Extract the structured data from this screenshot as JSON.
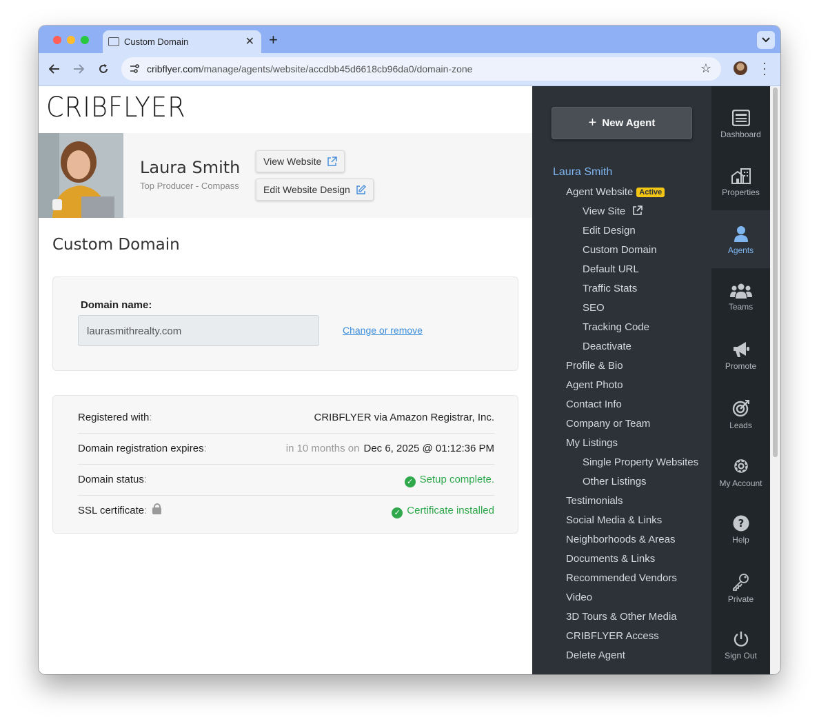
{
  "browser": {
    "tab_title": "Custom Domain",
    "url_host": "cribflyer.com",
    "url_path": "/manage/agents/website/accdbb45d6618cb96da0/domain-zone"
  },
  "brand": {
    "logo_text": "CRIBFLYER"
  },
  "agent": {
    "name": "Laura Smith",
    "title": "Top Producer - Compass",
    "view_website_label": "View Website",
    "edit_design_label": "Edit Website Design"
  },
  "page": {
    "heading": "Custom Domain",
    "domain_label": "Domain name:",
    "domain_value": "laurasmithrealty.com",
    "change_link": "Change or remove"
  },
  "details": {
    "registered_label": "Registered with",
    "registered_value": "CRIBFLYER via Amazon Registrar, Inc.",
    "expires_label": "Domain registration expires",
    "expires_relative": "in 10 months on",
    "expires_value": "Dec 6, 2025 @ 01:12:36 PM",
    "status_label": "Domain status",
    "status_value": "Setup complete.",
    "ssl_label": "SSL certificate",
    "ssl_value": "Certificate installed",
    "colon": ":"
  },
  "sidebar": {
    "new_agent_label": "New Agent",
    "agent_name": "Laura Smith",
    "agent_website": "Agent Website",
    "active_badge": "Active",
    "view_site": "View Site",
    "edit_design": "Edit Design",
    "custom_domain": "Custom Domain",
    "default_url": "Default URL",
    "traffic_stats": "Traffic Stats",
    "seo": "SEO",
    "tracking_code": "Tracking Code",
    "deactivate": "Deactivate",
    "profile_bio": "Profile & Bio",
    "agent_photo": "Agent Photo",
    "contact_info": "Contact Info",
    "company_team": "Company or Team",
    "my_listings": "My Listings",
    "single_property": "Single Property Websites",
    "other_listings": "Other Listings",
    "testimonials": "Testimonials",
    "social_media": "Social Media & Links",
    "neighborhoods": "Neighborhoods & Areas",
    "documents": "Documents & Links",
    "vendors": "Recommended Vendors",
    "video": "Video",
    "tours": "3D Tours & Other Media",
    "access": "CRIBFLYER Access",
    "delete_agent": "Delete Agent"
  },
  "rail": {
    "dashboard": "Dashboard",
    "properties": "Properties",
    "agents": "Agents",
    "teams": "Teams",
    "promote": "Promote",
    "leads": "Leads",
    "my_account": "My Account",
    "help": "Help",
    "private": "Private",
    "sign_out": "Sign Out"
  },
  "colors": {
    "accent_blue": "#7fb6f0",
    "success_green": "#2ea84a",
    "badge_yellow": "#f3c614",
    "sidebar_bg": "#2d3238",
    "rail_bg": "#21262b"
  }
}
